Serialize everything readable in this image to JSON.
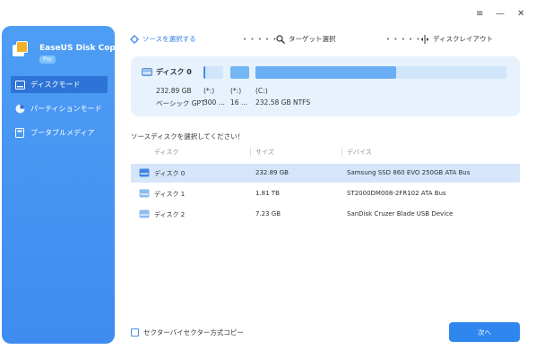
{
  "window": {
    "controls": {
      "menu": "≡",
      "minimize": "—",
      "close": "✕"
    }
  },
  "sidebar": {
    "app_name": "EaseUS Disk Copy",
    "badge": "Pro",
    "items": [
      {
        "label": "ディスクモード",
        "icon": "disk-icon"
      },
      {
        "label": "パーティションモード",
        "icon": "pie-icon"
      },
      {
        "label": "ブータブルメディア",
        "icon": "bootable-icon"
      }
    ]
  },
  "steps": {
    "source": "ソースを選択する",
    "target": "ターゲット選択",
    "layout": "ディスクレイアウト",
    "dots": "• • • • •"
  },
  "preview": {
    "disk_name": "ディスク 0",
    "size": "232.89 GB",
    "scheme": "ベーシック GPT",
    "parts": [
      {
        "label": "(*:)",
        "value": "300 ..."
      },
      {
        "label": "(*:)",
        "value": "16 ..."
      },
      {
        "label": "(C:)",
        "value": "232.58 GB NTFS"
      }
    ]
  },
  "table": {
    "prompt": "ソースディスクを選択してください！",
    "headers": [
      "ディスク",
      "サイズ",
      "デバイス"
    ],
    "rows": [
      {
        "disk": "ディスク 0",
        "size": "232.89 GB",
        "device": "Samsung SSD 860 EVO 250GB ATA Bus",
        "selected": true
      },
      {
        "disk": "ディスク 1",
        "size": "1.81 TB",
        "device": "ST2000DM008-2FR102 ATA Bus",
        "selected": false
      },
      {
        "disk": "ディスク 2",
        "size": "7.23 GB",
        "device": "SanDisk  Cruzer Blade    USB Device",
        "selected": false
      }
    ]
  },
  "footer": {
    "sector_copy_label": "セクターバイセクター方式コピー",
    "next_label": "次へ"
  },
  "colors": {
    "accent": "#2f86ef",
    "sidebar": "#4e9df5",
    "selected_row": "#d6e6fa"
  }
}
